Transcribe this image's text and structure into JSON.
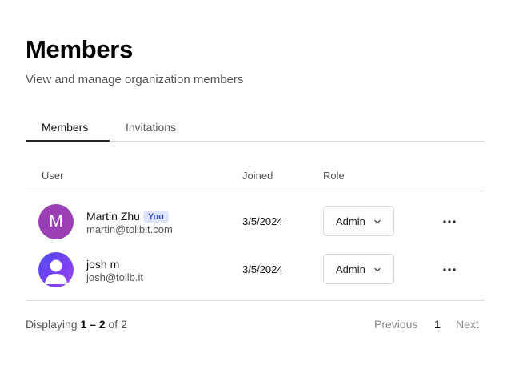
{
  "header": {
    "title": "Members",
    "subtitle": "View and manage organization members"
  },
  "tabs": [
    {
      "label": "Members",
      "active": true
    },
    {
      "label": "Invitations",
      "active": false
    }
  ],
  "table": {
    "columns": [
      "User",
      "Joined",
      "Role"
    ],
    "rows": [
      {
        "avatar_letter": "M",
        "avatar_color": "#9a3fb4",
        "name": "Martin Zhu",
        "badge": "You",
        "email": "martin@tollbit.com",
        "joined": "3/5/2024",
        "role": "Admin",
        "actions_icon": "more-horizontal-icon"
      },
      {
        "avatar_icon": "default-user-icon",
        "name": "josh m",
        "email": "josh@tollb.it",
        "joined": "3/5/2024",
        "role": "Admin",
        "actions_icon": "more-horizontal-icon"
      }
    ]
  },
  "footer": {
    "displaying_prefix": "Displaying",
    "range": "1 – 2",
    "of_text": "of",
    "total": "2",
    "previous_label": "Previous",
    "current_page": "1",
    "next_label": "Next"
  },
  "colors": {
    "badge_bg": "#dde4fb",
    "badge_text": "#3346c9",
    "active_tab_underline": "#222222"
  }
}
